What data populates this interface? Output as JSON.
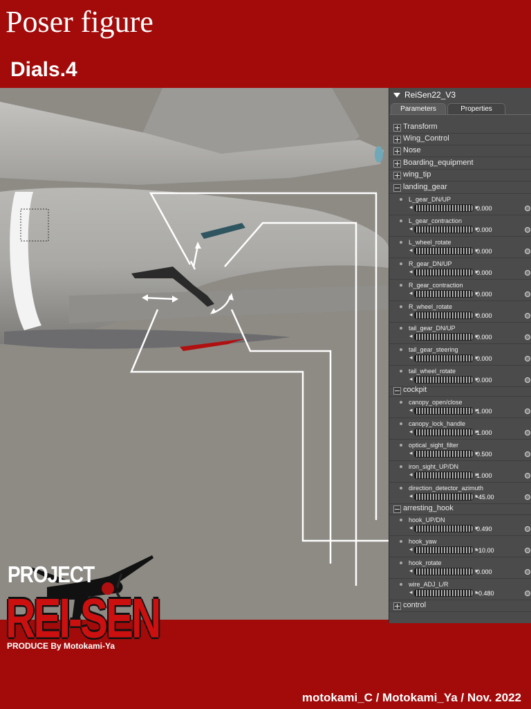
{
  "header": {
    "title": "Poser figure",
    "subtitle": "Dials.4"
  },
  "footer": {
    "credit": "motokami_C / Motokami_Ya / Nov. 2022"
  },
  "logo": {
    "project": "PROJECT",
    "name": "REI-SEN",
    "produce": "PRODUCE By Motokami-Ya"
  },
  "panel": {
    "figure_name": "ReiSen22_V3",
    "tabs": [
      "Parameters",
      "Properties"
    ],
    "groups_top": [
      "Transform",
      "Wing_Control",
      "Nose",
      "Boarding_equipment",
      "wing_tip"
    ],
    "landing_gear": {
      "label": "landing_gear",
      "dials": [
        {
          "name": "L_gear_DN/UP",
          "value": "0.000"
        },
        {
          "name": "L_gear_contraction",
          "value": "0.000"
        },
        {
          "name": "L_wheel_rotate",
          "value": "0.000"
        },
        {
          "name": "R_gear_DN/UP",
          "value": "0.000"
        },
        {
          "name": "R_gear_contraction",
          "value": "0.000"
        },
        {
          "name": "R_wheel_rotate",
          "value": "0.000"
        },
        {
          "name": "tail_gear_DN/UP",
          "value": "0.000"
        },
        {
          "name": "tail_gear_steering",
          "value": "0.000"
        },
        {
          "name": "tail_wheel_rotate",
          "value": "0.000"
        }
      ]
    },
    "cockpit": {
      "label": "cockpit",
      "dials": [
        {
          "name": "canopy_open/close",
          "value": "1.000"
        },
        {
          "name": "canopy_lock_handle",
          "value": "1.000"
        },
        {
          "name": "optical_sight_filter",
          "value": "0.500"
        },
        {
          "name": "iron_sight_UP/DN",
          "value": "1.000"
        },
        {
          "name": "direction_detector_azimuth",
          "value": "-45.00"
        }
      ]
    },
    "arresting_hook": {
      "label": "arresting_hook",
      "dials": [
        {
          "name": "hook_UP/DN",
          "value": "0.490"
        },
        {
          "name": "hook_yaw",
          "value": "-10.00"
        },
        {
          "name": "hook_rotate",
          "value": "0.000"
        },
        {
          "name": "wire_ADJ_L/R",
          "value": "-0.480"
        }
      ]
    },
    "control": {
      "label": "control"
    }
  },
  "colors": {
    "background_red": "#a30b0b",
    "viewport_gray": "#8e8b85",
    "panel_gray": "#4b4b4b"
  }
}
